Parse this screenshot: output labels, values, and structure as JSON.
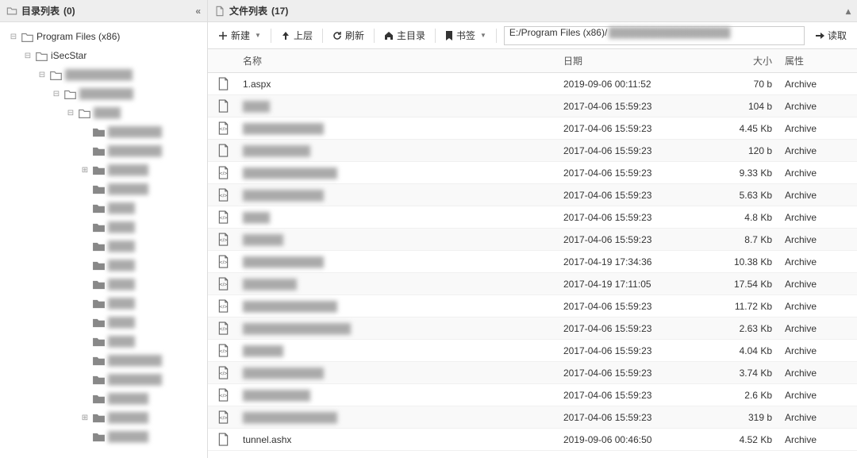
{
  "left": {
    "title_label": "目录列表",
    "title_count": "(0)",
    "collapse_glyph": "«",
    "tree": [
      {
        "level": 0,
        "toggle": "-",
        "icon": "folder",
        "label": "Program Files (x86)",
        "blur": false
      },
      {
        "level": 1,
        "toggle": "-",
        "icon": "folder",
        "label": "iSecStar",
        "blur": false
      },
      {
        "level": 2,
        "toggle": "-",
        "icon": "folder",
        "label": "██████████",
        "blur": true
      },
      {
        "level": 3,
        "toggle": "-",
        "icon": "folder",
        "label": "████████",
        "blur": true
      },
      {
        "level": 4,
        "toggle": "-",
        "icon": "folder",
        "label": "████",
        "blur": true
      },
      {
        "level": 5,
        "toggle": "",
        "icon": "folder-solid",
        "label": "████████",
        "blur": true
      },
      {
        "level": 5,
        "toggle": "",
        "icon": "folder-solid",
        "label": "████████",
        "blur": true
      },
      {
        "level": 5,
        "toggle": "+",
        "icon": "folder-solid",
        "label": "██████",
        "blur": true
      },
      {
        "level": 5,
        "toggle": "",
        "icon": "folder-solid",
        "label": "██████",
        "blur": true
      },
      {
        "level": 5,
        "toggle": "",
        "icon": "folder-solid",
        "label": "████",
        "blur": true
      },
      {
        "level": 5,
        "toggle": "",
        "icon": "folder-solid",
        "label": "████",
        "blur": true
      },
      {
        "level": 5,
        "toggle": "",
        "icon": "folder-solid",
        "label": "████",
        "blur": true
      },
      {
        "level": 5,
        "toggle": "",
        "icon": "folder-solid",
        "label": "████",
        "blur": true
      },
      {
        "level": 5,
        "toggle": "",
        "icon": "folder-solid",
        "label": "████",
        "blur": true
      },
      {
        "level": 5,
        "toggle": "",
        "icon": "folder-solid",
        "label": "████",
        "blur": true
      },
      {
        "level": 5,
        "toggle": "",
        "icon": "folder-solid",
        "label": "████",
        "blur": true
      },
      {
        "level": 5,
        "toggle": "",
        "icon": "folder-solid",
        "label": "████",
        "blur": true
      },
      {
        "level": 5,
        "toggle": "",
        "icon": "folder-solid",
        "label": "████████",
        "blur": true
      },
      {
        "level": 5,
        "toggle": "",
        "icon": "folder-solid",
        "label": "████████",
        "blur": true
      },
      {
        "level": 5,
        "toggle": "",
        "icon": "folder-solid",
        "label": "██████",
        "blur": true
      },
      {
        "level": 5,
        "toggle": "+",
        "icon": "folder-solid",
        "label": "██████",
        "blur": true
      },
      {
        "level": 5,
        "toggle": "",
        "icon": "folder-solid",
        "label": "██████",
        "blur": true
      }
    ]
  },
  "right": {
    "title_label": "文件列表",
    "title_count": "(17)",
    "collapse_glyph": "▴",
    "toolbar": {
      "new_label": "新建",
      "up_label": "上层",
      "refresh_label": "刷新",
      "home_label": "主目录",
      "bookmark_label": "书签",
      "path_value": "E:/Program Files (x86)/",
      "path_blur_tail": "██████████████████",
      "read_label": "读取"
    },
    "columns": {
      "name": "名称",
      "date": "日期",
      "size": "大小",
      "attr": "属性"
    },
    "files": [
      {
        "icon": "file",
        "name": "1.aspx",
        "blur": false,
        "date": "2019-09-06 00:11:52",
        "size": "70 b",
        "attr": "Archive"
      },
      {
        "icon": "file",
        "name": "████",
        "blur": true,
        "date": "2017-04-06 15:59:23",
        "size": "104 b",
        "attr": "Archive"
      },
      {
        "icon": "code",
        "name": "████████████",
        "blur": true,
        "date": "2017-04-06 15:59:23",
        "size": "4.45 Kb",
        "attr": "Archive"
      },
      {
        "icon": "file",
        "name": "██████████",
        "blur": true,
        "date": "2017-04-06 15:59:23",
        "size": "120 b",
        "attr": "Archive"
      },
      {
        "icon": "code",
        "name": "██████████████",
        "blur": true,
        "date": "2017-04-06 15:59:23",
        "size": "9.33 Kb",
        "attr": "Archive"
      },
      {
        "icon": "code",
        "name": "████████████",
        "blur": true,
        "date": "2017-04-06 15:59:23",
        "size": "5.63 Kb",
        "attr": "Archive"
      },
      {
        "icon": "code",
        "name": "████",
        "blur": true,
        "date": "2017-04-06 15:59:23",
        "size": "4.8 Kb",
        "attr": "Archive"
      },
      {
        "icon": "code",
        "name": "██████",
        "blur": true,
        "date": "2017-04-06 15:59:23",
        "size": "8.7 Kb",
        "attr": "Archive"
      },
      {
        "icon": "code",
        "name": "████████████",
        "blur": true,
        "date": "2017-04-19 17:34:36",
        "size": "10.38 Kb",
        "attr": "Archive"
      },
      {
        "icon": "code",
        "name": "████████",
        "blur": true,
        "date": "2017-04-19 17:11:05",
        "size": "17.54 Kb",
        "attr": "Archive"
      },
      {
        "icon": "code",
        "name": "██████████████",
        "blur": true,
        "date": "2017-04-06 15:59:23",
        "size": "11.72 Kb",
        "attr": "Archive"
      },
      {
        "icon": "code",
        "name": "████████████████",
        "blur": true,
        "date": "2017-04-06 15:59:23",
        "size": "2.63 Kb",
        "attr": "Archive"
      },
      {
        "icon": "code",
        "name": "██████",
        "blur": true,
        "date": "2017-04-06 15:59:23",
        "size": "4.04 Kb",
        "attr": "Archive"
      },
      {
        "icon": "code",
        "name": "████████████",
        "blur": true,
        "date": "2017-04-06 15:59:23",
        "size": "3.74 Kb",
        "attr": "Archive"
      },
      {
        "icon": "code",
        "name": "██████████",
        "blur": true,
        "date": "2017-04-06 15:59:23",
        "size": "2.6 Kb",
        "attr": "Archive"
      },
      {
        "icon": "code",
        "name": "██████████████",
        "blur": true,
        "date": "2017-04-06 15:59:23",
        "size": "319 b",
        "attr": "Archive"
      },
      {
        "icon": "file",
        "name": "tunnel.ashx",
        "blur": false,
        "date": "2019-09-06 00:46:50",
        "size": "4.52 Kb",
        "attr": "Archive"
      }
    ]
  }
}
